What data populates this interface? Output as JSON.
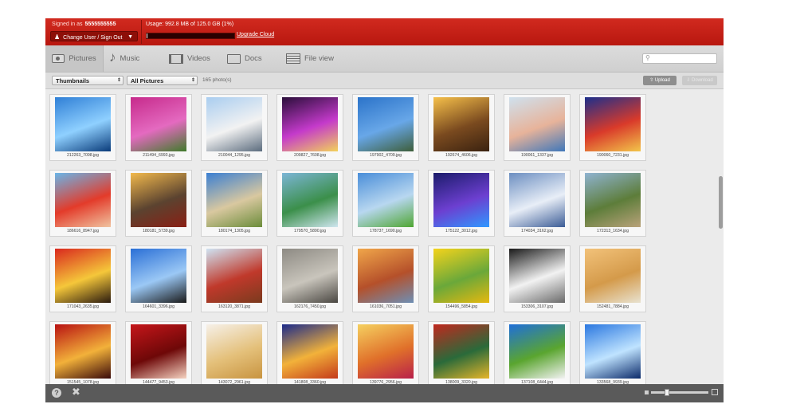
{
  "topbar": {
    "signed_in_label": "Signed in as",
    "account": "5555555555",
    "change_user_label": "Change User / Sign Out",
    "usage_text": "Usage: 992.8 MB of 125.0 GB (1%)",
    "usage_fraction": 0.01,
    "upgrade_label": "Upgrade Cloud"
  },
  "tabs": [
    {
      "label": "Pictures",
      "icon": "camera-icon",
      "active": true
    },
    {
      "label": "Music",
      "icon": "music-note-icon",
      "active": false
    },
    {
      "label": "Videos",
      "icon": "film-icon",
      "active": false
    },
    {
      "label": "Docs",
      "icon": "document-icon",
      "active": false
    },
    {
      "label": "File view",
      "icon": "file-view-icon",
      "active": false
    }
  ],
  "search": {
    "placeholder": "",
    "icon": "search-icon"
  },
  "toolbar": {
    "view_select": "Thumbnails",
    "filter_select": "All Pictures",
    "photo_count": "165  photo(s)",
    "upload_label": "Upload",
    "download_label": "Download"
  },
  "photos": [
    {
      "name": "212263_7098.jpg",
      "colors": [
        "#2f7fd6",
        "#8fd0ff",
        "#0a3b7a"
      ]
    },
    {
      "name": "211494_6993.jpg",
      "colors": [
        "#c62a8b",
        "#e46ac0",
        "#3f7b2a"
      ]
    },
    {
      "name": "210044_1295.jpg",
      "colors": [
        "#a9cdf0",
        "#f2f2f2",
        "#5b6c7e"
      ]
    },
    {
      "name": "209827_7608.jpg",
      "colors": [
        "#2a0e3a",
        "#c43acb",
        "#f2d25a"
      ]
    },
    {
      "name": "197902_4709.jpg",
      "colors": [
        "#2b73c9",
        "#68a7e8",
        "#3e5e3a"
      ]
    },
    {
      "name": "192674_4606.jpg",
      "colors": [
        "#f6c04a",
        "#7a4a1f",
        "#3a2210"
      ]
    },
    {
      "name": "190061_1337.jpg",
      "colors": [
        "#cfe1ee",
        "#e7b39a",
        "#3f77b9"
      ]
    },
    {
      "name": "190060_7231.jpg",
      "colors": [
        "#1c2f8c",
        "#d93a2a",
        "#f2c54a"
      ]
    },
    {
      "name": "186616_8947.jpg",
      "colors": [
        "#6ab5e8",
        "#e33b2a",
        "#f0c3a0"
      ]
    },
    {
      "name": "180181_5739.jpg",
      "colors": [
        "#f2b94c",
        "#5b4330",
        "#8a1f14"
      ]
    },
    {
      "name": "180174_1305.jpg",
      "colors": [
        "#3b7fd2",
        "#d9c8a0",
        "#6b8c3a"
      ]
    },
    {
      "name": "179570_5890.jpg",
      "colors": [
        "#7bb5d6",
        "#3b8f4a",
        "#cfe6ef"
      ]
    },
    {
      "name": "178737_1690.jpg",
      "colors": [
        "#4a8ed9",
        "#b8d7f0",
        "#4fa632"
      ]
    },
    {
      "name": "175122_3012.jpg",
      "colors": [
        "#1c1c6b",
        "#6c3fd0",
        "#2f98ff"
      ]
    },
    {
      "name": "174034_3162.jpg",
      "colors": [
        "#6d8fc1",
        "#e8eef7",
        "#3b5c96"
      ]
    },
    {
      "name": "172313_1634.jpg",
      "colors": [
        "#8fb3d1",
        "#5d7d3a",
        "#b9a27a"
      ]
    },
    {
      "name": "171043_2635.jpg",
      "colors": [
        "#d9281e",
        "#f5c73a",
        "#2a1a0f"
      ]
    },
    {
      "name": "164601_3396.jpg",
      "colors": [
        "#2a6fd6",
        "#9bc8f5",
        "#1a1a1a"
      ]
    },
    {
      "name": "163120_3871.jpg",
      "colors": [
        "#cfe3f2",
        "#c0392b",
        "#7a3a1e"
      ]
    },
    {
      "name": "162176_7450.jpg",
      "colors": [
        "#8d8a83",
        "#c9c5bc",
        "#4a4742"
      ]
    },
    {
      "name": "161036_7051.jpg",
      "colors": [
        "#f0a64a",
        "#b5502a",
        "#6e8fb5"
      ]
    },
    {
      "name": "154496_5854.jpg",
      "colors": [
        "#f4d31c",
        "#6aa83a",
        "#e6b80f"
      ]
    },
    {
      "name": "153306_3107.jpg",
      "colors": [
        "#1a1a1a",
        "#f2f2f2",
        "#6a6a6a"
      ]
    },
    {
      "name": "152481_7884.jpg",
      "colors": [
        "#f2c27a",
        "#d49a4a",
        "#e8e2d0"
      ]
    },
    {
      "name": "151545_1078.jpg",
      "colors": [
        "#b81212",
        "#f2b13a",
        "#3a0a0a"
      ]
    },
    {
      "name": "144477_9453.jpg",
      "colors": [
        "#c5161a",
        "#6e0808",
        "#f5d2c0"
      ]
    },
    {
      "name": "143072_2961.jpg",
      "colors": [
        "#f6f0e8",
        "#e4c07a",
        "#c89440"
      ]
    },
    {
      "name": "141808_3360.jpg",
      "colors": [
        "#1b2a8a",
        "#f2b23a",
        "#c43a1a"
      ]
    },
    {
      "name": "139776_2956.jpg",
      "colors": [
        "#f5d060",
        "#e0702a",
        "#b8204a"
      ]
    },
    {
      "name": "138009_3320.jpg",
      "colors": [
        "#c0281e",
        "#2a6a3a",
        "#e5b52a"
      ]
    },
    {
      "name": "137108_6444.jpg",
      "colors": [
        "#1f6fd9",
        "#5aa52f",
        "#f2f2f2"
      ]
    },
    {
      "name": "133568_9939.jpg",
      "colors": [
        "#2b78e0",
        "#bfe3ff",
        "#0b2a6a"
      ]
    }
  ],
  "bottombar": {
    "help_icon": "help-icon",
    "tools_icon": "tools-icon",
    "zoom_level": 0.25
  }
}
